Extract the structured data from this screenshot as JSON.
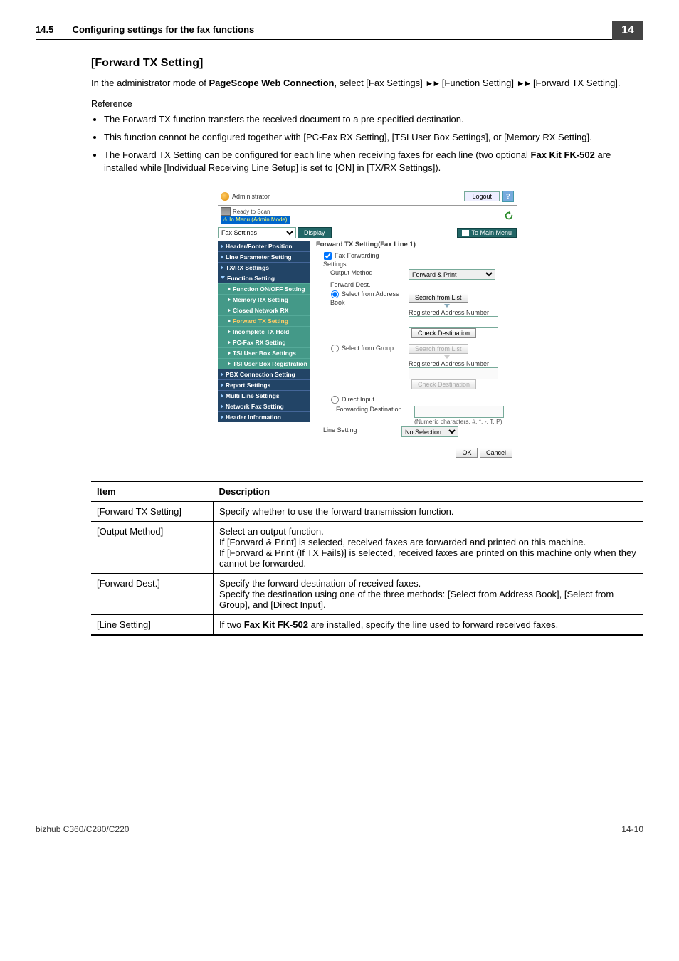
{
  "header": {
    "secnum": "14.5",
    "title": "Configuring settings for the fax functions",
    "chapter": "14"
  },
  "h2": "[Forward TX Setting]",
  "intro": {
    "pre": "In the administrator mode of ",
    "bold1": "PageScope Web Connection",
    "mid1": ", select [Fax Settings] ",
    "arr": "►►",
    "mid2": " [Function Setting] ",
    "post": " [Forward TX Setting]."
  },
  "refLabel": "Reference",
  "bullets": [
    {
      "t": "The Forward TX function transfers the received document to a pre-specified destination."
    },
    {
      "t": "This function cannot be configured together with [PC-Fax RX Setting], [TSI User Box Settings], or [Memory RX Setting]."
    },
    {
      "pre": "The Forward TX Setting can be configured for each line when receiving faxes for each line (two optional ",
      "bold": "Fax Kit FK-502",
      "post": " are installed while [Individual Receiving Line Setup] is set to [ON] in [TX/RX Settings])."
    }
  ],
  "shot": {
    "admin": "Administrator",
    "logout": "Logout",
    "ready": "Ready to Scan",
    "menuMode": "In Menu (Admin Mode)",
    "selector": "Fax Settings",
    "display": "Display",
    "toMain": "To Main Menu",
    "side": {
      "hdrFooter": "Header/Footer Position",
      "lineParam": "Line Parameter Setting",
      "txrx": "TX/RX Settings",
      "funcSetting": "Function Setting",
      "funcOnOff": "Function ON/OFF Setting",
      "memRx": "Memory RX Setting",
      "closedNet": "Closed Network RX",
      "fwdTx": "Forward TX Setting",
      "incomplete": "Incomplete TX Hold",
      "pcfax": "PC-Fax RX Setting",
      "tsiBox": "TSI User Box Settings",
      "tsiReg": "TSI User Box Registration",
      "pbx": "PBX Connection Setting",
      "report": "Report Settings",
      "multiLine": "Multi Line Settings",
      "netFax": "Network Fax Setting",
      "hdrInfo": "Header Information"
    },
    "pane": {
      "title": "Forward TX Setting(Fax Line 1)",
      "fwdSettings": "Fax Forwarding Settings",
      "outputMethod": "Output Method",
      "outputVal": "Forward & Print",
      "fwdDest": "Forward Dest.",
      "selAddr": "Select from Address Book",
      "searchList": "Search from List",
      "regAddrNum": "Registered Address Number",
      "checkDest": "Check Destination",
      "selGroup": "Select from Group",
      "directInput": "Direct Input",
      "fwdDestLabel": "Forwarding Destination",
      "numNote": "(Numeric characters, #, *, -, T, P)",
      "lineSetting": "Line Setting",
      "lineVal": "No Selection",
      "ok": "OK",
      "cancel": "Cancel"
    }
  },
  "table": {
    "h1": "Item",
    "h2": "Description",
    "rows": [
      {
        "c1": "[Forward TX Setting]",
        "c2": "Specify whether to use the forward transmission function."
      },
      {
        "c1": "[Output Method]",
        "c2": "Select an output function.\nIf [Forward & Print] is selected, received faxes are forwarded and printed on this machine.\nIf [Forward & Print (If TX Fails)] is selected, received faxes are printed on this machine only when they cannot be forwarded."
      },
      {
        "c1": "[Forward Dest.]",
        "c2": "Specify the forward destination of received faxes.\nSpecify the destination using one of the three methods: [Select from Address Book], [Select from Group], and [Direct Input]."
      },
      {
        "c1": "[Line Setting]",
        "c2pre": "If two ",
        "c2bold": "Fax Kit FK-502",
        "c2post": " are installed, specify the line used to forward received faxes."
      }
    ]
  },
  "footer": {
    "left": "bizhub C360/C280/C220",
    "right": "14-10"
  }
}
